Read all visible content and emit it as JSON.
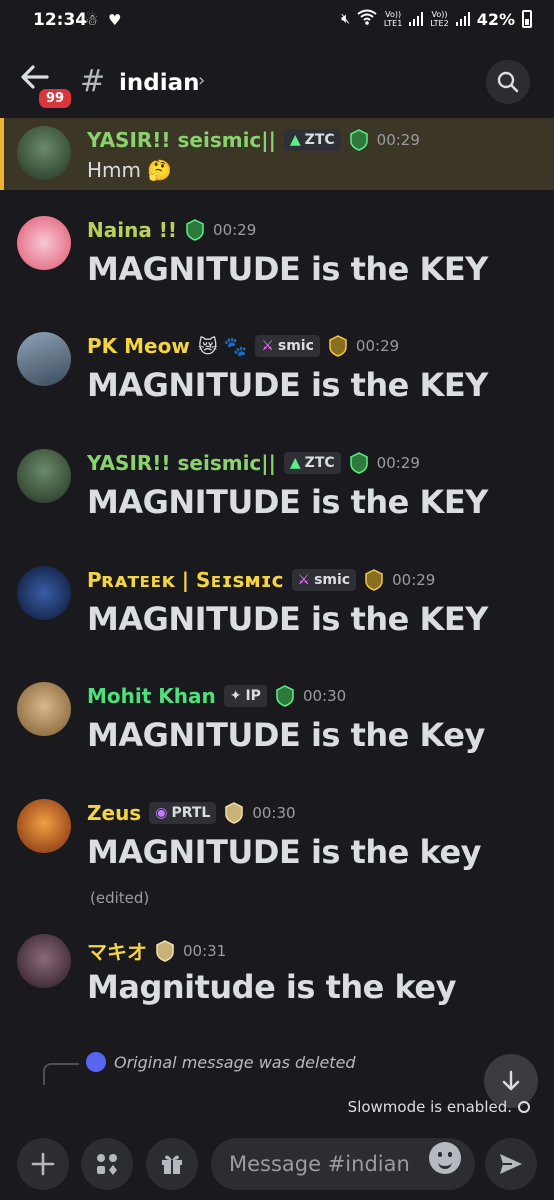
{
  "status_bar": {
    "time": "12:34",
    "sim1": "Vo))\nLTE1",
    "sim2": "Vo))\nLTE2",
    "battery": "42%"
  },
  "header": {
    "unread_count": "99",
    "channel_name": "indian"
  },
  "messages": [
    {
      "username": "YASIR!! seismic||",
      "name_color": "#8ad26e",
      "tag": "ZTC",
      "tag_icon": "flame-icon",
      "role_icon": "green-shield-icon",
      "time": "00:29",
      "text": "Hmm",
      "emoji": "🤔",
      "highlighted": true
    },
    {
      "username": "Naina !!",
      "name_color": "#b7d15a",
      "role_icon": "green-shield-icon",
      "time": "00:29",
      "text": "MAGNITUDE is the KEY"
    },
    {
      "username": "PK  Meow",
      "name_emoji": "😿 🐾",
      "name_color": "#f5d442",
      "tag": "smic",
      "tag_icon": "sword-icon",
      "role_icon": "gold-shield-icon",
      "time": "00:29",
      "text": "MAGNITUDE is the KEY"
    },
    {
      "username": "YASIR!! seismic||",
      "name_color": "#8ad26e",
      "tag": "ZTC",
      "tag_icon": "flame-icon",
      "role_icon": "green-shield-icon",
      "time": "00:29",
      "text": "MAGNITUDE is the KEY"
    },
    {
      "username": "Pʀᴀᴛᴇᴇᴋ | Sᴇɪsᴍɪᴄ",
      "name_color": "#f5d442",
      "tag": "smic",
      "tag_icon": "sword-icon",
      "role_icon": "gold-shield-icon",
      "time": "00:29",
      "text": "MAGNITUDE is the KEY"
    },
    {
      "username": "Mohit Khan",
      "name_color": "#4ee07a",
      "tag": "IP",
      "tag_icon": "sparkle-icon",
      "role_icon": "green-shield-icon",
      "time": "00:30",
      "text": "MAGNITUDE is the Key"
    },
    {
      "username": "Zeus",
      "name_color": "#f5d442",
      "tag": "PRTL",
      "tag_icon": "portal-icon",
      "role_icon": "pale-shield-icon",
      "time": "00:30",
      "text": "MAGNITUDE is the key",
      "edited": "(edited)"
    },
    {
      "username": "マキオ",
      "name_color": "#f5d442",
      "role_icon": "pale-shield-icon",
      "time": "00:31",
      "text": "Magnitude is the key"
    }
  ],
  "reply_preview": "Original message was deleted",
  "slowmode_text": "Slowmode is enabled.",
  "composer": {
    "placeholder": "Message #indian"
  }
}
